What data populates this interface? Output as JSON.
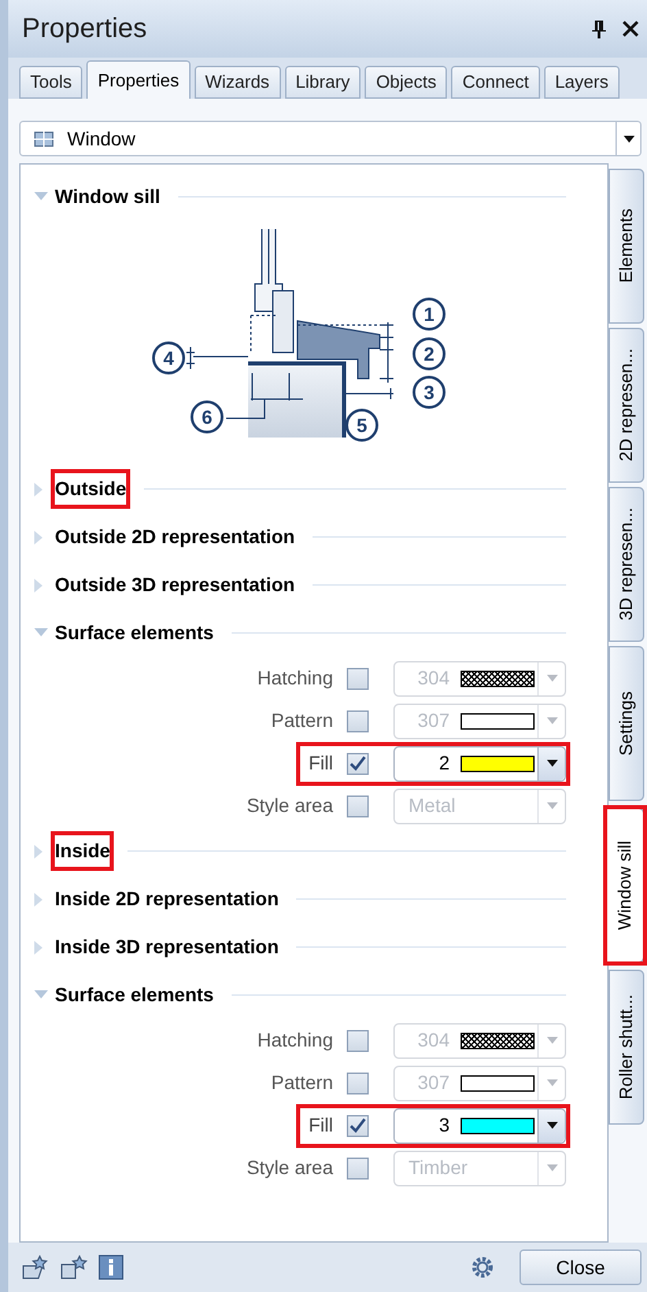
{
  "window": {
    "title": "Properties"
  },
  "tabs": [
    {
      "label": "Tools",
      "selected": false
    },
    {
      "label": "Properties",
      "selected": true
    },
    {
      "label": "Wizards",
      "selected": false
    },
    {
      "label": "Library",
      "selected": false
    },
    {
      "label": "Objects",
      "selected": false
    },
    {
      "label": "Connect",
      "selected": false
    },
    {
      "label": "Layers",
      "selected": false
    }
  ],
  "element_select": {
    "value": "Window"
  },
  "sections": [
    {
      "kind": "heading",
      "title": "Window sill",
      "expanded": true,
      "highlighted": false
    },
    {
      "kind": "diagram",
      "callouts": [
        "1",
        "2",
        "3",
        "4",
        "5",
        "6"
      ]
    },
    {
      "kind": "heading",
      "title": "Outside",
      "expanded": false,
      "highlighted": true
    },
    {
      "kind": "heading",
      "title": "Outside 2D representation",
      "expanded": false,
      "highlighted": false
    },
    {
      "kind": "heading",
      "title": "Outside 3D representation",
      "expanded": false,
      "highlighted": false
    },
    {
      "kind": "heading",
      "title": "Surface elements",
      "expanded": true,
      "highlighted": false
    },
    {
      "kind": "hatching",
      "label": "Hatching",
      "checked": false,
      "value": "304",
      "highlighted": false
    },
    {
      "kind": "pattern",
      "label": "Pattern",
      "checked": false,
      "value": "307",
      "highlighted": false
    },
    {
      "kind": "fill",
      "label": "Fill",
      "checked": true,
      "value": "2",
      "color": "#ffff00",
      "highlighted": true
    },
    {
      "kind": "style",
      "label": "Style area",
      "checked": false,
      "value": "Metal",
      "highlighted": false
    },
    {
      "kind": "heading",
      "title": "Inside",
      "expanded": false,
      "highlighted": true
    },
    {
      "kind": "heading",
      "title": "Inside 2D representation",
      "expanded": false,
      "highlighted": false
    },
    {
      "kind": "heading",
      "title": "Inside 3D representation",
      "expanded": false,
      "highlighted": false
    },
    {
      "kind": "heading",
      "title": "Surface elements",
      "expanded": true,
      "highlighted": false
    },
    {
      "kind": "hatching",
      "label": "Hatching",
      "checked": false,
      "value": "304",
      "highlighted": false
    },
    {
      "kind": "pattern",
      "label": "Pattern",
      "checked": false,
      "value": "307",
      "highlighted": false
    },
    {
      "kind": "fill",
      "label": "Fill",
      "checked": true,
      "value": "3",
      "color": "#00ffff",
      "highlighted": true
    },
    {
      "kind": "style",
      "label": "Style area",
      "checked": false,
      "value": "Timber",
      "highlighted": false
    }
  ],
  "side_tabs": [
    {
      "label": "Elements",
      "selected": false,
      "highlighted": false
    },
    {
      "label": "2D represen...",
      "selected": false,
      "highlighted": false
    },
    {
      "label": "3D represen...",
      "selected": false,
      "highlighted": false
    },
    {
      "label": "Settings",
      "selected": false,
      "highlighted": false
    },
    {
      "label": "Window sill",
      "selected": true,
      "highlighted": true
    },
    {
      "label": "Roller shutt...",
      "selected": false,
      "highlighted": false
    }
  ],
  "footer": {
    "close_button": "Close"
  }
}
